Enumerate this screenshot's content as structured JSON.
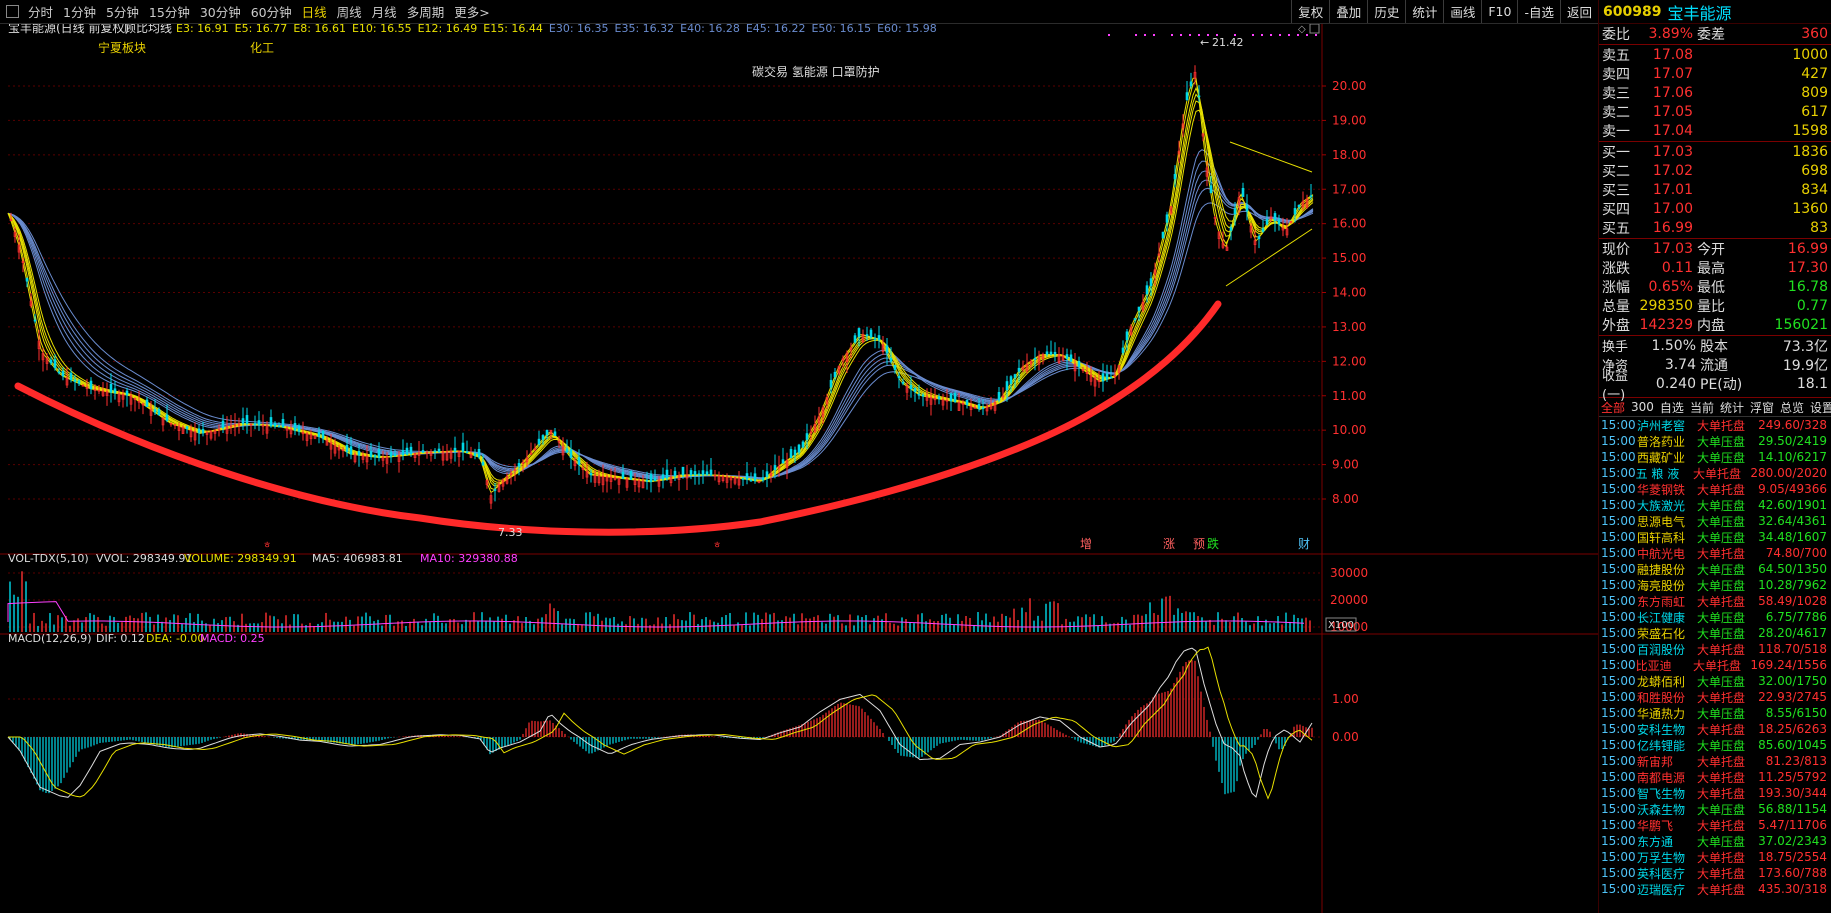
{
  "toolbar": {
    "tabs": [
      "分时",
      "1分钟",
      "5分钟",
      "15分钟",
      "30分钟",
      "60分钟",
      "日线",
      "周线",
      "月线",
      "多周期",
      "更多>"
    ],
    "active_index": 6,
    "buttons": [
      "复权",
      "叠加",
      "历史",
      "统计",
      "画线",
      "F10",
      "-自选",
      "返回"
    ]
  },
  "chart": {
    "title": "宝丰能源(日线 前复权)",
    "indicator": "顾比均线",
    "short_emas": [
      {
        "label": "E3: 16.91"
      },
      {
        "label": "E5: 16.77"
      },
      {
        "label": "E8: 16.61"
      },
      {
        "label": "E10: 16.55"
      },
      {
        "label": "E12: 16.49"
      },
      {
        "label": "E15: 16.44"
      }
    ],
    "long_emas": [
      {
        "label": "E30: 16.35"
      },
      {
        "label": "E35: 16.32"
      },
      {
        "label": "E40: 16.28"
      },
      {
        "label": "E45: 16.22"
      },
      {
        "label": "E50: 16.15"
      },
      {
        "label": "E60: 15.98"
      }
    ],
    "annotations": [
      "宁夏板块",
      "化工",
      "碳交易 氢能源 口罩防护"
    ],
    "price_axis": [
      "20.00",
      "19.00",
      "18.00",
      "17.00",
      "16.00",
      "15.00",
      "14.00",
      "13.00",
      "12.00",
      "11.00",
      "10.00",
      "9.00",
      "8.00"
    ],
    "high_label": "21.42",
    "low_label": "7.33",
    "event_markers": [
      "增",
      "涨",
      "预",
      "跌",
      "财"
    ],
    "vol": {
      "title": "VOL-TDX(5,10)",
      "vvol": "VVOL: 298349.91",
      "volume": "VOLUME: 298349.91",
      "ma5": "MA5: 406983.81",
      "ma10": "MA10: 329380.88",
      "axis": [
        "30000",
        "20000",
        "10000"
      ],
      "unit": "X100"
    },
    "macd": {
      "title": "MACD(12,26,9)",
      "dif": "DIF: 0.12",
      "dea": "DEA: -0.00",
      "macd": "MACD: 0.25",
      "axis": [
        "1.00",
        "0.00"
      ]
    },
    "colors": {
      "up": "#ff3030",
      "down": "#00d8e8",
      "short_ema": "#e8e000",
      "long_ema": "#6a8ccf",
      "trend": "#ff2a2a",
      "grid": "#5a0000"
    }
  },
  "panel": {
    "code": "600989",
    "name": "宝丰能源",
    "ratio_label": "委比",
    "ratio": "3.89%",
    "diff_label": "委差",
    "diff": "360",
    "asks": [
      {
        "label": "卖五",
        "price": "17.08",
        "vol": "1000"
      },
      {
        "label": "卖四",
        "price": "17.07",
        "vol": "427"
      },
      {
        "label": "卖三",
        "price": "17.06",
        "vol": "809"
      },
      {
        "label": "卖二",
        "price": "17.05",
        "vol": "617"
      },
      {
        "label": "卖一",
        "price": "17.04",
        "vol": "1598"
      }
    ],
    "bids": [
      {
        "label": "买一",
        "price": "17.03",
        "vol": "1836"
      },
      {
        "label": "买二",
        "price": "17.02",
        "vol": "698"
      },
      {
        "label": "买三",
        "price": "17.01",
        "vol": "834"
      },
      {
        "label": "买四",
        "price": "17.00",
        "vol": "1360"
      },
      {
        "label": "买五",
        "price": "16.99",
        "vol": "83"
      }
    ],
    "quote": [
      {
        "a": "现价",
        "b": "17.03",
        "bc": "red",
        "c": "今开",
        "d": "16.99",
        "dc": "red"
      },
      {
        "a": "涨跌",
        "b": "0.11",
        "bc": "red",
        "c": "最高",
        "d": "17.30",
        "dc": "red"
      },
      {
        "a": "涨幅",
        "b": "0.65%",
        "bc": "red",
        "c": "最低",
        "d": "16.78",
        "dc": "green"
      },
      {
        "a": "总量",
        "b": "298350",
        "bc": "yel",
        "c": "量比",
        "d": "0.77",
        "dc": "green"
      },
      {
        "a": "外盘",
        "b": "142329",
        "bc": "red",
        "c": "内盘",
        "d": "156021",
        "dc": "green"
      }
    ],
    "fund": [
      {
        "a": "换手",
        "b": "1.50%",
        "c": "股本",
        "d": "73.3亿"
      },
      {
        "a": "净资",
        "b": "3.74",
        "c": "流通",
        "d": "19.9亿"
      },
      {
        "a": "收益(一)",
        "b": "0.240",
        "c": "PE(动)",
        "d": "18.1"
      }
    ],
    "tabs": [
      "全部",
      "300",
      "自选",
      "当前",
      "统计",
      "浮窗",
      "总览",
      "设置"
    ],
    "list": [
      {
        "t": "15:00",
        "n": "泸州老窖",
        "k": "大单托盘",
        "x": "249.60/328",
        "nc": "cyan",
        "kc": "red",
        "xc": "red"
      },
      {
        "t": "15:00",
        "n": "普洛药业",
        "k": "大单压盘",
        "x": "29.50/2419",
        "nc": "yel",
        "kc": "green",
        "xc": "green"
      },
      {
        "t": "15:00",
        "n": "西藏矿业",
        "k": "大单压盘",
        "x": "14.10/6217",
        "nc": "yel",
        "kc": "green",
        "xc": "green"
      },
      {
        "t": "15:00",
        "n": "五 粮 液",
        "k": "大单托盘",
        "x": "280.00/2020",
        "nc": "cyan",
        "kc": "red",
        "xc": "red"
      },
      {
        "t": "15:00",
        "n": "华菱钢铁",
        "k": "大单托盘",
        "x": "9.05/49366",
        "nc": "red",
        "kc": "red",
        "xc": "red"
      },
      {
        "t": "15:00",
        "n": "大族激光",
        "k": "大单压盘",
        "x": "42.60/1901",
        "nc": "cyan",
        "kc": "green",
        "xc": "green"
      },
      {
        "t": "15:00",
        "n": "思源电气",
        "k": "大单压盘",
        "x": "32.64/4361",
        "nc": "yel",
        "kc": "green",
        "xc": "green"
      },
      {
        "t": "15:00",
        "n": "国轩高科",
        "k": "大单压盘",
        "x": "34.48/1607",
        "nc": "yel",
        "kc": "green",
        "xc": "green"
      },
      {
        "t": "15:00",
        "n": "中航光电",
        "k": "大单托盘",
        "x": "74.80/700",
        "nc": "red",
        "kc": "red",
        "xc": "red"
      },
      {
        "t": "15:00",
        "n": "融捷股份",
        "k": "大单压盘",
        "x": "64.50/1350",
        "nc": "yel",
        "kc": "green",
        "xc": "green"
      },
      {
        "t": "15:00",
        "n": "海亮股份",
        "k": "大单压盘",
        "x": "10.28/7962",
        "nc": "yel",
        "kc": "green",
        "xc": "green"
      },
      {
        "t": "15:00",
        "n": "东方雨虹",
        "k": "大单托盘",
        "x": "58.49/1028",
        "nc": "red",
        "kc": "red",
        "xc": "red"
      },
      {
        "t": "15:00",
        "n": "长江健康",
        "k": "大单压盘",
        "x": "6.75/7786",
        "nc": "cyan",
        "kc": "green",
        "xc": "green"
      },
      {
        "t": "15:00",
        "n": "荣盛石化",
        "k": "大单压盘",
        "x": "28.20/4617",
        "nc": "yel",
        "kc": "green",
        "xc": "green"
      },
      {
        "t": "15:00",
        "n": "百润股份",
        "k": "大单托盘",
        "x": "118.70/518",
        "nc": "cyan",
        "kc": "red",
        "xc": "red"
      },
      {
        "t": "15:00",
        "n": "比亚迪",
        "k": "大单托盘",
        "x": "169.24/1556",
        "nc": "red",
        "kc": "red",
        "xc": "red"
      },
      {
        "t": "15:00",
        "n": "龙蟒佰利",
        "k": "大单压盘",
        "x": "32.00/1750",
        "nc": "yel",
        "kc": "green",
        "xc": "green"
      },
      {
        "t": "15:00",
        "n": "和胜股份",
        "k": "大单托盘",
        "x": "22.93/2745",
        "nc": "red",
        "kc": "red",
        "xc": "red"
      },
      {
        "t": "15:00",
        "n": "华通热力",
        "k": "大单压盘",
        "x": "8.55/6150",
        "nc": "yel",
        "kc": "green",
        "xc": "green"
      },
      {
        "t": "15:00",
        "n": "安科生物",
        "k": "大单托盘",
        "x": "18.25/6263",
        "nc": "cyan",
        "kc": "red",
        "xc": "red"
      },
      {
        "t": "15:00",
        "n": "亿纬锂能",
        "k": "大单压盘",
        "x": "85.60/1045",
        "nc": "cyan",
        "kc": "green",
        "xc": "green"
      },
      {
        "t": "15:00",
        "n": "新宙邦",
        "k": "大单托盘",
        "x": "81.23/813",
        "nc": "red",
        "kc": "red",
        "xc": "red"
      },
      {
        "t": "15:00",
        "n": "南都电源",
        "k": "大单托盘",
        "x": "11.25/5792",
        "nc": "red",
        "kc": "red",
        "xc": "red"
      },
      {
        "t": "15:00",
        "n": "智飞生物",
        "k": "大单托盘",
        "x": "193.30/344",
        "nc": "cyan",
        "kc": "red",
        "xc": "red"
      },
      {
        "t": "15:00",
        "n": "沃森生物",
        "k": "大单压盘",
        "x": "56.88/1154",
        "nc": "cyan",
        "kc": "green",
        "xc": "green"
      },
      {
        "t": "15:00",
        "n": "华鹏飞",
        "k": "大单托盘",
        "x": "5.47/11706",
        "nc": "red",
        "kc": "red",
        "xc": "red"
      },
      {
        "t": "15:00",
        "n": "东方通",
        "k": "大单压盘",
        "x": "37.02/2343",
        "nc": "cyan",
        "kc": "green",
        "xc": "green"
      },
      {
        "t": "15:00",
        "n": "万孚生物",
        "k": "大单托盘",
        "x": "18.75/2554",
        "nc": "cyan",
        "kc": "red",
        "xc": "red"
      },
      {
        "t": "15:00",
        "n": "英科医疗",
        "k": "大单托盘",
        "x": "173.60/788",
        "nc": "cyan",
        "kc": "red",
        "xc": "red"
      },
      {
        "t": "15:00",
        "n": "迈瑞医疗",
        "k": "大单托盘",
        "x": "435.30/318",
        "nc": "cyan",
        "kc": "red",
        "xc": "red"
      }
    ]
  }
}
